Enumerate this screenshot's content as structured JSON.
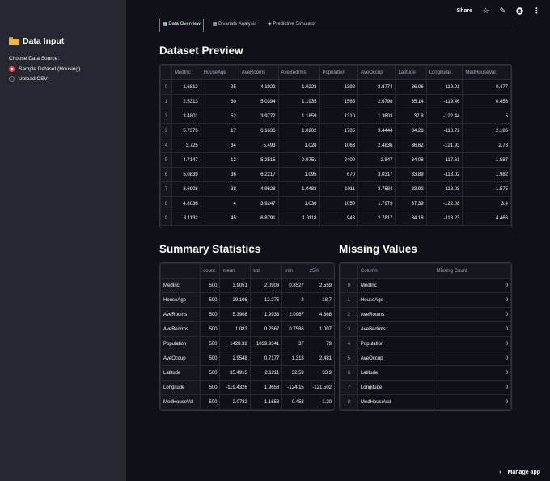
{
  "sidebar": {
    "title": "Data Input",
    "source_label": "Choose Data Source:",
    "options": [
      "Sample Dataset (Housing)",
      "Upload CSV"
    ],
    "selected": "Sample Dataset (Housing)"
  },
  "topbar": {
    "share": "Share"
  },
  "tabs": [
    "Data Overview",
    "Bivariate Analysis",
    "Predictive Simulator"
  ],
  "preview": {
    "title": "Dataset Preview",
    "columns": [
      "",
      "MedInc",
      "HouseAge",
      "AveRooms",
      "AveBedrms",
      "Population",
      "AveOccup",
      "Latitude",
      "Longitude",
      "MedHouseVal"
    ],
    "rows": [
      [
        "0",
        "1.6812",
        "25",
        "4.1922",
        "1.0223",
        "1392",
        "3.8774",
        "36.06",
        "-119.01",
        "0.477"
      ],
      [
        "1",
        "2.5313",
        "30",
        "5.0394",
        "1.1935",
        "1565",
        "2.6798",
        "35.14",
        "-119.46",
        "0.458"
      ],
      [
        "2",
        "3.4801",
        "52",
        "3.9772",
        "1.1859",
        "1310",
        "1.3603",
        "37.8",
        "-122.44",
        "5"
      ],
      [
        "3",
        "5.7376",
        "17",
        "6.1636",
        "1.0202",
        "1705",
        "3.4444",
        "34.28",
        "-118.72",
        "2.186"
      ],
      [
        "4",
        "3.725",
        "34",
        "5.493",
        "1.028",
        "1063",
        "2.4836",
        "36.62",
        "-121.93",
        "2.78"
      ],
      [
        "5",
        "4.7147",
        "12",
        "5.2515",
        "0.9751",
        "2400",
        "2.847",
        "34.08",
        "-117.61",
        "1.587"
      ],
      [
        "6",
        "5.0839",
        "36",
        "6.2217",
        "1.095",
        "670",
        "3.0317",
        "33.89",
        "-118.02",
        "1.982"
      ],
      [
        "7",
        "3.6908",
        "38",
        "4.9628",
        "1.0483",
        "1011",
        "3.7584",
        "33.92",
        "-118.08",
        "1.575"
      ],
      [
        "8",
        "4.8036",
        "4",
        "3.9247",
        "1.036",
        "1050",
        "1.7979",
        "37.39",
        "-122.08",
        "3.4"
      ],
      [
        "9",
        "8.1132",
        "45",
        "6.8791",
        "1.0118",
        "943",
        "2.7817",
        "34.18",
        "-118.23",
        "4.466"
      ]
    ]
  },
  "summary": {
    "title": "Summary Statistics",
    "columns": [
      "",
      "count",
      "mean",
      "std",
      "min",
      "25%"
    ],
    "rows": [
      [
        "MedInc",
        "500",
        "3.9051",
        "2.0903",
        "0.8527",
        "2.559"
      ],
      [
        "HouseAge",
        "500",
        "29.106",
        "12.275",
        "2",
        "18.7"
      ],
      [
        "AveRooms",
        "500",
        "5.3908",
        "1.9933",
        "2.0967",
        "4.368"
      ],
      [
        "AveBedrms",
        "500",
        "1.083",
        "0.2567",
        "0.7586",
        "1.007"
      ],
      [
        "Population",
        "500",
        "1428.32",
        "1039.9341",
        "37",
        "79"
      ],
      [
        "AveOccup",
        "500",
        "2.9548",
        "0.7177",
        "1.313",
        "2.481"
      ],
      [
        "Latitude",
        "500",
        "35.4915",
        "2.1211",
        "32.59",
        "33.9"
      ],
      [
        "Longitude",
        "500",
        "-119.4326",
        "1.9658",
        "-124.15",
        "-121.502"
      ],
      [
        "MedHouseVal",
        "500",
        "2.0732",
        "1.1658",
        "0.458",
        "1.20"
      ]
    ]
  },
  "missing": {
    "title": "Missing Values",
    "columns": [
      "",
      "Column",
      "Missing Count"
    ],
    "rows": [
      [
        "0",
        "MedInc",
        "0"
      ],
      [
        "1",
        "HouseAge",
        "0"
      ],
      [
        "2",
        "AveRooms",
        "0"
      ],
      [
        "3",
        "AveBedrms",
        "0"
      ],
      [
        "4",
        "Population",
        "0"
      ],
      [
        "5",
        "AveOccup",
        "0"
      ],
      [
        "6",
        "Latitude",
        "0"
      ],
      [
        "7",
        "Longitude",
        "0"
      ],
      [
        "8",
        "MedHouseVal",
        "0"
      ]
    ]
  },
  "footer": {
    "manage": "Manage app"
  }
}
